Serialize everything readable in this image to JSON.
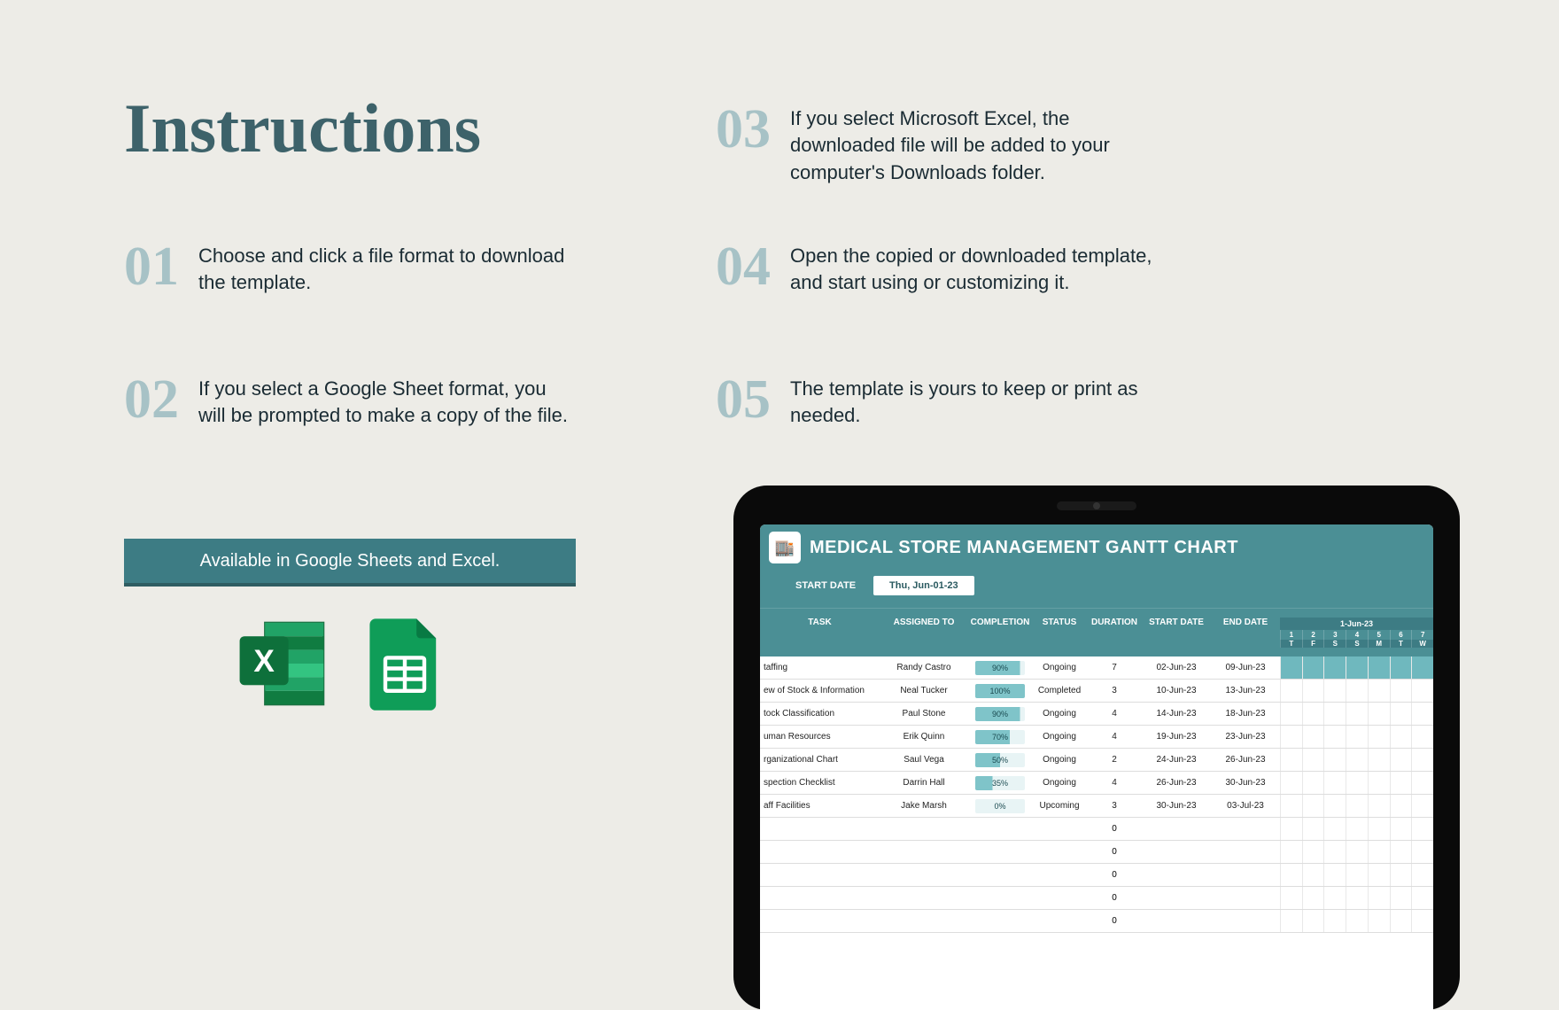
{
  "title": "Instructions",
  "steps": [
    {
      "num": "01",
      "text": "Choose and click a file format to download the template."
    },
    {
      "num": "02",
      "text": "If you select a Google Sheet format, you will be prompted to make a copy of the file."
    },
    {
      "num": "03",
      "text": "If you select Microsoft Excel, the downloaded file will be added to your computer's Downloads folder."
    },
    {
      "num": "04",
      "text": "Open the copied or downloaded template, and start using or customizing it."
    },
    {
      "num": "05",
      "text": "The template is yours to keep or print as needed."
    }
  ],
  "banner": "Available in Google Sheets and Excel.",
  "spreadsheet": {
    "title": "MEDICAL STORE MANAGEMENT GANTT CHART",
    "start_date_label": "START DATE",
    "start_date_value": "Thu, Jun-01-23",
    "columns": {
      "task": "TASK",
      "assigned": "ASSIGNED TO",
      "completion": "COMPLETION",
      "status": "STATUS",
      "duration": "DURATION",
      "start": "START DATE",
      "end": "END DATE"
    },
    "gantt_header": {
      "month": "1-Jun-23",
      "days": [
        "1",
        "2",
        "3",
        "4",
        "5",
        "6",
        "7"
      ],
      "weekdays": [
        "T",
        "F",
        "S",
        "S",
        "M",
        "T",
        "W"
      ]
    },
    "rows": [
      {
        "task": "taffing",
        "assigned": "Randy Castro",
        "completion": "90%",
        "comp_pct": 90,
        "status": "Ongoing",
        "duration": "7",
        "start": "02-Jun-23",
        "end": "09-Jun-23",
        "bar": [
          1,
          7
        ]
      },
      {
        "task": "ew of Stock & Information",
        "assigned": "Neal Tucker",
        "completion": "100%",
        "comp_pct": 100,
        "status": "Completed",
        "duration": "3",
        "start": "10-Jun-23",
        "end": "13-Jun-23",
        "bar": null
      },
      {
        "task": "tock Classification",
        "assigned": "Paul Stone",
        "completion": "90%",
        "comp_pct": 90,
        "status": "Ongoing",
        "duration": "4",
        "start": "14-Jun-23",
        "end": "18-Jun-23",
        "bar": null
      },
      {
        "task": "uman Resources",
        "assigned": "Erik Quinn",
        "completion": "70%",
        "comp_pct": 70,
        "status": "Ongoing",
        "duration": "4",
        "start": "19-Jun-23",
        "end": "23-Jun-23",
        "bar": null
      },
      {
        "task": "rganizational Chart",
        "assigned": "Saul Vega",
        "completion": "50%",
        "comp_pct": 50,
        "status": "Ongoing",
        "duration": "2",
        "start": "24-Jun-23",
        "end": "26-Jun-23",
        "bar": null
      },
      {
        "task": "spection Checklist",
        "assigned": "Darrin Hall",
        "completion": "35%",
        "comp_pct": 35,
        "status": "Ongoing",
        "duration": "4",
        "start": "26-Jun-23",
        "end": "30-Jun-23",
        "bar": null
      },
      {
        "task": "aff Facilities",
        "assigned": "Jake Marsh",
        "completion": "0%",
        "comp_pct": 0,
        "status": "Upcoming",
        "duration": "3",
        "start": "30-Jun-23",
        "end": "03-Jul-23",
        "bar": null
      }
    ],
    "empty_rows": [
      "0",
      "0",
      "0",
      "0",
      "0"
    ]
  }
}
